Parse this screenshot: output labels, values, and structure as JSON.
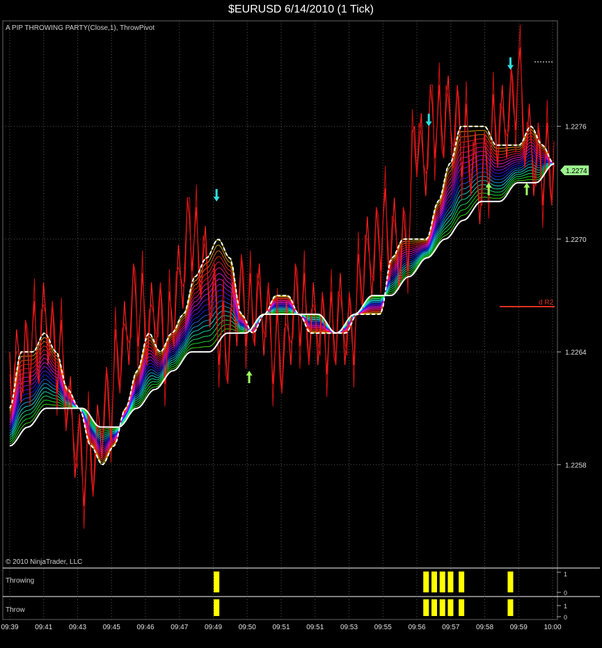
{
  "chart": {
    "title": "$EURUSD  6/14/2010 (1 Tick)",
    "indicator_label": "A PIP THROWING PARTY(Close,1), ThrowPivot",
    "copyright": "© 2010 NinjaTrader, LLC",
    "price_marker": "1.2274",
    "pivot_label": "d R2"
  },
  "panels": {
    "throwing": {
      "label": "Throwing",
      "ticks": [
        "1",
        "0"
      ]
    },
    "throw": {
      "label": "Throw",
      "ticks": [
        "1",
        "0"
      ]
    }
  },
  "chart_data": {
    "type": "line",
    "title": "$EURUSD  6/14/2010 (1 Tick)",
    "x_ticks": [
      "09:39",
      "09:41",
      "09:43",
      "09:45",
      "09:46",
      "09:47",
      "09:49",
      "09:50",
      "09:51",
      "09:51",
      "09:53",
      "09:55",
      "09:56",
      "09:57",
      "09:58",
      "09:59",
      "10:00"
    ],
    "y_ticks": [
      "1.2276",
      "1.2270",
      "1.2264",
      "1.2258"
    ],
    "ylim": [
      1.22535,
      1.22805
    ],
    "grid": true,
    "series": [
      {
        "role": "price",
        "color": "#ff2020",
        "values": [
          1.2264,
          1.2262,
          1.2264,
          1.2263,
          1.2264,
          1.2265,
          1.2264,
          1.2265,
          1.2266,
          1.2265,
          1.2264,
          1.2264,
          1.2263,
          1.2261,
          1.226,
          1.2259,
          1.2258,
          1.2258,
          1.2259,
          1.2258,
          1.226,
          1.2261,
          1.2261,
          1.2262,
          1.2264,
          1.2264,
          1.2265,
          1.2266,
          1.2267,
          1.2266,
          1.2266,
          1.2265,
          1.2266,
          1.2266,
          1.2265,
          1.2264,
          1.2266,
          1.2267,
          1.2268,
          1.2269,
          1.2271,
          1.227,
          1.2269,
          1.2269,
          1.2268,
          1.2267,
          1.2266,
          1.2265,
          1.2264,
          1.2265,
          1.2266,
          1.2267,
          1.2267,
          1.2266,
          1.2266,
          1.2267,
          1.2266,
          1.2266,
          1.2265,
          1.2264,
          1.2264,
          1.2264,
          1.2265,
          1.2266,
          1.2267,
          1.2266,
          1.2266,
          1.2265,
          1.2266,
          1.2265,
          1.2265,
          1.2265,
          1.2265,
          1.2266,
          1.2266,
          1.2265,
          1.2265,
          1.2266,
          1.2268,
          1.2269,
          1.2269,
          1.2269,
          1.227,
          1.2271,
          1.227,
          1.227,
          1.227,
          1.2269,
          1.227,
          1.2271,
          1.2276,
          1.2275,
          1.2274,
          1.2275,
          1.2277,
          1.2276,
          1.2276,
          1.2277,
          1.2276,
          1.2276,
          1.2276,
          1.2275,
          1.2275,
          1.2274,
          1.2273,
          1.2273,
          1.2274,
          1.2275,
          1.2276,
          1.2276,
          1.2276,
          1.2277,
          1.2277,
          1.2279,
          1.2277,
          1.2275,
          1.2275,
          1.2274,
          1.2274,
          1.2274,
          1.2274,
          1.2274
        ]
      },
      {
        "role": "pivot-dashed",
        "color": "#ffffff",
        "values": [
          1.2261,
          1.2264,
          1.2264,
          1.2265,
          1.2264,
          1.2262,
          1.2261,
          1.2259,
          1.2258,
          1.2259,
          1.2261,
          1.2263,
          1.2265,
          1.2264,
          1.2265,
          1.2266,
          1.2268,
          1.2269,
          1.227,
          1.2269,
          1.2266,
          1.2265,
          1.2266,
          1.2267,
          1.2267,
          1.2266,
          1.2265,
          1.2265,
          1.2265,
          1.2265,
          1.2266,
          1.2266,
          1.2266,
          1.2269,
          1.227,
          1.227,
          1.227,
          1.2272,
          1.2274,
          1.2276,
          1.2276,
          1.2276,
          1.2275,
          1.2275,
          1.2275,
          1.2276,
          1.2275,
          1.2274
        ]
      },
      {
        "role": "base-white",
        "color": "#ffffff",
        "values": [
          1.2259,
          1.226,
          1.2261,
          1.2261,
          1.2261,
          1.226,
          1.226,
          1.2261,
          1.2262,
          1.2263,
          1.2264,
          1.2264,
          1.2265,
          1.2265,
          1.2266,
          1.2266,
          1.2266,
          1.2266,
          1.2265,
          1.2266,
          1.2267,
          1.2267,
          1.2268,
          1.2269,
          1.227,
          1.2271,
          1.2272,
          1.2272,
          1.2273,
          1.2273,
          1.2274
        ]
      }
    ],
    "arrows": [
      {
        "time_index": 0.38,
        "price": 1.2272,
        "dir": "down",
        "color": "#30e0e0"
      },
      {
        "time_index": 0.44,
        "price": 1.2263,
        "dir": "up",
        "color": "#a0ff60"
      },
      {
        "time_index": 0.77,
        "price": 1.2276,
        "dir": "down",
        "color": "#30e0e0"
      },
      {
        "time_index": 0.88,
        "price": 1.2273,
        "dir": "up",
        "color": "#a0ff60"
      },
      {
        "time_index": 0.92,
        "price": 1.2279,
        "dir": "down",
        "color": "#30e0e0"
      },
      {
        "time_index": 0.95,
        "price": 1.2273,
        "dir": "up",
        "color": "#a0ff60"
      }
    ],
    "pivot_level": {
      "name": "d R2",
      "price": 1.22673,
      "color": "#e03020"
    },
    "throwing_bars": [
      0.38,
      0.765,
      0.78,
      0.795,
      0.81,
      0.83,
      0.92
    ],
    "throw_bars": [
      0.38,
      0.765,
      0.78,
      0.795,
      0.81,
      0.83,
      0.92
    ]
  }
}
